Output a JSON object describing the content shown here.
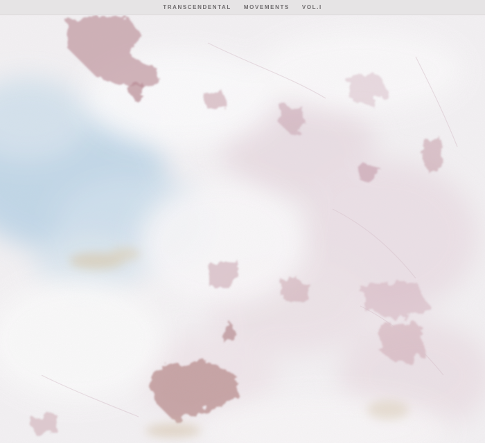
{
  "title_bar": {
    "words": [
      "TRANSCENDENTAL",
      "MOVEMENTS",
      "VOL.I"
    ]
  },
  "artwork": {
    "icon": "marble-painting-texture",
    "colors": {
      "base": "#f3f1f3",
      "blue_wash": "#b9d3e6",
      "rose": "#b98a93",
      "mauve": "#c7a6b5",
      "ochre": "#d8c6a6"
    }
  }
}
